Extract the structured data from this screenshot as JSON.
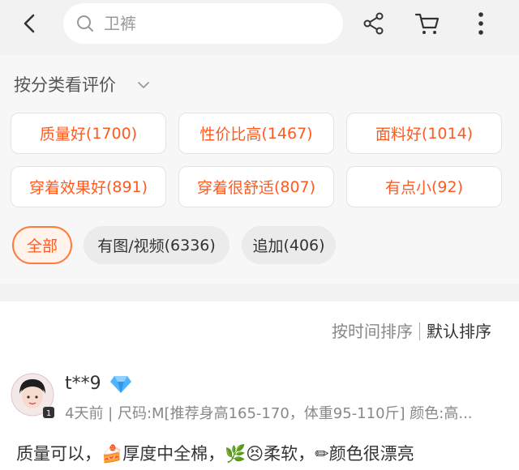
{
  "header": {
    "search_text": "卫裤"
  },
  "filter": {
    "title": "按分类看评价",
    "tags": [
      {
        "label": "质量好",
        "count": "(1700)"
      },
      {
        "label": "性价比高",
        "count": "(1467)"
      },
      {
        "label": "面料好",
        "count": "(1014)"
      },
      {
        "label": "穿着效果好",
        "count": "(891)"
      },
      {
        "label": "穿着很舒适",
        "count": "(807)"
      },
      {
        "label": "有点小",
        "count": "(92)"
      }
    ],
    "pills": [
      {
        "label": "全部",
        "count": ""
      },
      {
        "label": "有图/视频",
        "count": "(6336)"
      },
      {
        "label": "追加",
        "count": "(406)"
      }
    ]
  },
  "sort": {
    "by_time": "按时间排序",
    "default": "默认排序"
  },
  "review": {
    "username": "t**9",
    "meta": "4天前 | 尺码:M[推荐身高165-170，体重95-110斤] 颜色:高...",
    "content": "质量可以，🍰厚度中全棉，🌿😣柔软，✏颜色很漂亮"
  },
  "colors": {
    "accent": "#ff5a1f",
    "background": "#f2f2f2",
    "card": "#ffffff"
  },
  "icons": [
    "back-icon",
    "search-icon",
    "share-icon",
    "cart-icon",
    "more-icon",
    "chevron-down-icon",
    "diamond-icon",
    "avatar"
  ]
}
